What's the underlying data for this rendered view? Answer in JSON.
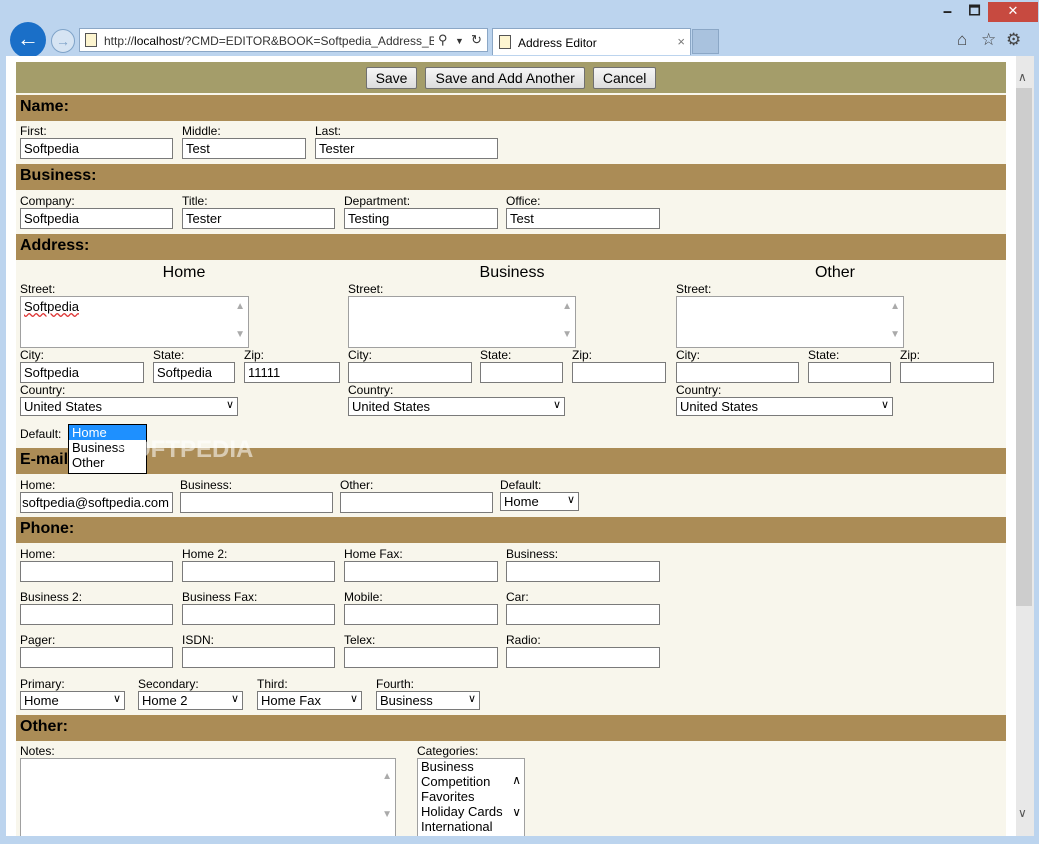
{
  "browser": {
    "url_prefix": "http://",
    "url_host": "localhost",
    "url_rest": "/?CMD=EDITOR&BOOK=Softpedia_Address_B",
    "tab_title": "Address Editor",
    "tab_close": "×",
    "minimize": "🗕",
    "maximize": "🗖",
    "close": "✕"
  },
  "toolbar": {
    "save": "Save",
    "save_add": "Save and Add Another",
    "cancel": "Cancel"
  },
  "sections": {
    "name": "Name:",
    "business": "Business:",
    "address": "Address:",
    "email": "E-mail:",
    "phone": "Phone:",
    "other": "Other:"
  },
  "name": {
    "first_label": "First:",
    "first": "Softpedia",
    "middle_label": "Middle:",
    "middle": "Test",
    "last_label": "Last:",
    "last": "Tester"
  },
  "business": {
    "company_label": "Company:",
    "company": "Softpedia",
    "title_label": "Title:",
    "title": "Tester",
    "department_label": "Department:",
    "department": "Testing",
    "office_label": "Office:",
    "office": "Test"
  },
  "address": {
    "columns": [
      {
        "head": "Home",
        "street": "Softpedia",
        "city": "Softpedia",
        "state": "Softpedia",
        "zip": "11111",
        "country": "United States"
      },
      {
        "head": "Business",
        "street": "",
        "city": "",
        "state": "",
        "zip": "",
        "country": "United States"
      },
      {
        "head": "Other",
        "street": "",
        "city": "",
        "state": "",
        "zip": "",
        "country": "United States"
      }
    ],
    "street_label": "Street:",
    "city_label": "City:",
    "state_label": "State:",
    "zip_label": "Zip:",
    "country_label": "Country:",
    "default_label": "Default:",
    "default_options": [
      "Home",
      "Business",
      "Other"
    ]
  },
  "email": {
    "home_label": "Home:",
    "home": "softpedia@softpedia.com",
    "business_label": "Business:",
    "business": "",
    "other_label": "Other:",
    "other": "",
    "default_label": "Default:",
    "default": "Home"
  },
  "phone": {
    "home_label": "Home:",
    "home2_label": "Home 2:",
    "homefax_label": "Home Fax:",
    "business_label": "Business:",
    "business2_label": "Business 2:",
    "businessfax_label": "Business Fax:",
    "mobile_label": "Mobile:",
    "car_label": "Car:",
    "pager_label": "Pager:",
    "isdn_label": "ISDN:",
    "telex_label": "Telex:",
    "radio_label": "Radio:",
    "primary_label": "Primary:",
    "primary": "Home",
    "secondary_label": "Secondary:",
    "secondary": "Home 2",
    "third_label": "Third:",
    "third": "Home Fax",
    "fourth_label": "Fourth:",
    "fourth": "Business"
  },
  "other": {
    "notes_label": "Notes:",
    "categories_label": "Categories:",
    "categories": [
      "Business",
      "Competition",
      "Favorites",
      "Holiday Cards",
      "International"
    ]
  },
  "watermark": "SOFTPEDIA"
}
